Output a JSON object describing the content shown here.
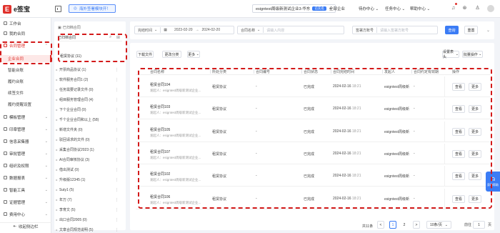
{
  "topbar": {
    "logo_mark": "E",
    "logo_text": "e签宝",
    "promo": "海外签署模块开！",
    "tenant": "esigntest周级新测试企业3-华东",
    "tenant_badge": "已实名",
    "nav_all": "全部企业",
    "nav_todo": "待办中心",
    "nav_tasks": "任务中心",
    "nav_help": "帮助中心"
  },
  "sidebar": {
    "items": [
      {
        "label": "工作台"
      },
      {
        "label": "我的合同"
      },
      {
        "label": "合同管理",
        "arrow": "⌃"
      },
      {
        "label": "模板管理",
        "arrow": "⌄"
      },
      {
        "label": "印章管理",
        "arrow": "⌄"
      },
      {
        "label": "信息采集器",
        "arrow": "⌄"
      },
      {
        "label": "审批管理",
        "arrow": "⌄"
      },
      {
        "label": "组织及权限",
        "arrow": "⌄"
      },
      {
        "label": "数据报表",
        "arrow": "⌄"
      },
      {
        "label": "智能工具",
        "arrow": "⌄"
      },
      {
        "label": "证据管理",
        "arrow": "⌄"
      },
      {
        "label": "费用中心",
        "arrow": "⌄"
      }
    ],
    "sub_items": [
      {
        "label": "企业合同"
      },
      {
        "label": "智能台账"
      },
      {
        "label": "履约台账"
      },
      {
        "label": "续签文件"
      },
      {
        "label": "履约提醒设置"
      }
    ],
    "collapse": "收起侧边栏"
  },
  "tree": {
    "header": "已归档合同",
    "search_value": "已归档合同",
    "root": "租赁协议 (11)",
    "rows": [
      {
        "label": "开票商品协议 (1)"
      },
      {
        "label": "软件服务合同1 (2)"
      },
      {
        "label": "任务需要记录文件 (0)"
      },
      {
        "label": "组目服务管理合同 (4)"
      },
      {
        "label": "下个企业合同 (0)"
      },
      {
        "label": "千个企业合同和以上 (58)"
      },
      {
        "label": "新增文件夹 (0)"
      },
      {
        "label": "驳回请求的文件 (0)"
      },
      {
        "label": "采集合同协议2023 (1)"
      },
      {
        "label": "AI合同审核协议 (3)"
      },
      {
        "label": "借出测试 (0)"
      },
      {
        "label": "升级版12345 (1)"
      },
      {
        "label": "Suty1 (5)"
      },
      {
        "label": "年万 (7)"
      },
      {
        "label": "李育文 (5)"
      },
      {
        "label": "出口合同2005 (0)"
      },
      {
        "label": "文章合同规范说明 (5)"
      }
    ]
  },
  "filter": {
    "date_type": "完结时间",
    "date_from": "2023-02-20",
    "date_to": "2024-02-20",
    "name_type": "合同名称",
    "name_placeholder": "请输入内容",
    "sign_type": "签署方账号",
    "sign_placeholder": "请输入签署方账号",
    "query": "查询",
    "reset": "重置"
  },
  "toolbar": {
    "download": "下载文件",
    "change_cat": "更改分类",
    "more": "更多",
    "set_header": "设置表头",
    "batch_ops": "批量操作"
  },
  "table": {
    "headers": [
      "合同名称",
      "所处分类",
      "合同编号",
      "合同状态",
      "合同完结时间",
      "发起人",
      "合同约定有效期",
      "操作"
    ],
    "rows": [
      {
        "name": "租赁合同104",
        "sub": "发起人：esigntest周级新测试企业...",
        "category": "租赁协议",
        "code": "-",
        "status": "已完成",
        "date": "2024-02-16",
        "time": "18:21",
        "initiator": "esigntest周级新",
        "validity": "-"
      },
      {
        "name": "租赁合同103",
        "sub": "发起人：esigntest周级新测试企业...",
        "category": "租赁协议",
        "code": "-",
        "status": "已完成",
        "date": "2024-02-16",
        "time": "18:21",
        "initiator": "esigntest周级新",
        "validity": "-"
      },
      {
        "name": "租赁合同105",
        "sub": "发起人：esigntest周级新测试企业...",
        "category": "租赁协议",
        "code": "-",
        "status": "已完成",
        "date": "2024-02-16",
        "time": "18:21",
        "initiator": "esigntest周级新",
        "validity": "-"
      },
      {
        "name": "租赁合同107",
        "sub": "发起人：esigntest周级新测试企业...",
        "category": "租赁协议",
        "code": "-",
        "status": "已完成",
        "date": "2024-02-16",
        "time": "18:21",
        "initiator": "esigntest周级新",
        "validity": "-"
      },
      {
        "name": "租赁合同102",
        "sub": "发起人：esigntest周级新测试企业...",
        "category": "租赁协议",
        "code": "-",
        "status": "已完成",
        "date": "2024-02-16",
        "time": "18:21",
        "initiator": "esigntest周级新",
        "validity": "-"
      },
      {
        "name": "租赁合同106",
        "sub": "发起人：esigntest周级新测试企业...",
        "category": "租赁协议",
        "code": "-",
        "status": "已完成",
        "date": "2024-02-16",
        "time": "18:21",
        "initiator": "esigntest周级新",
        "validity": "-"
      }
    ],
    "action_view": "查看",
    "action_more": "更多"
  },
  "pager": {
    "total": "共11条",
    "prev": "<",
    "page1": "1",
    "page2": "2",
    "next": ">",
    "size": "10条/页",
    "goto_label": "前往",
    "goto_value": "1",
    "page_unit": "页"
  },
  "widget": {
    "label": "获取帮助"
  },
  "colors": {
    "brand": "#e0312c",
    "accent": "#3b7cf5"
  }
}
